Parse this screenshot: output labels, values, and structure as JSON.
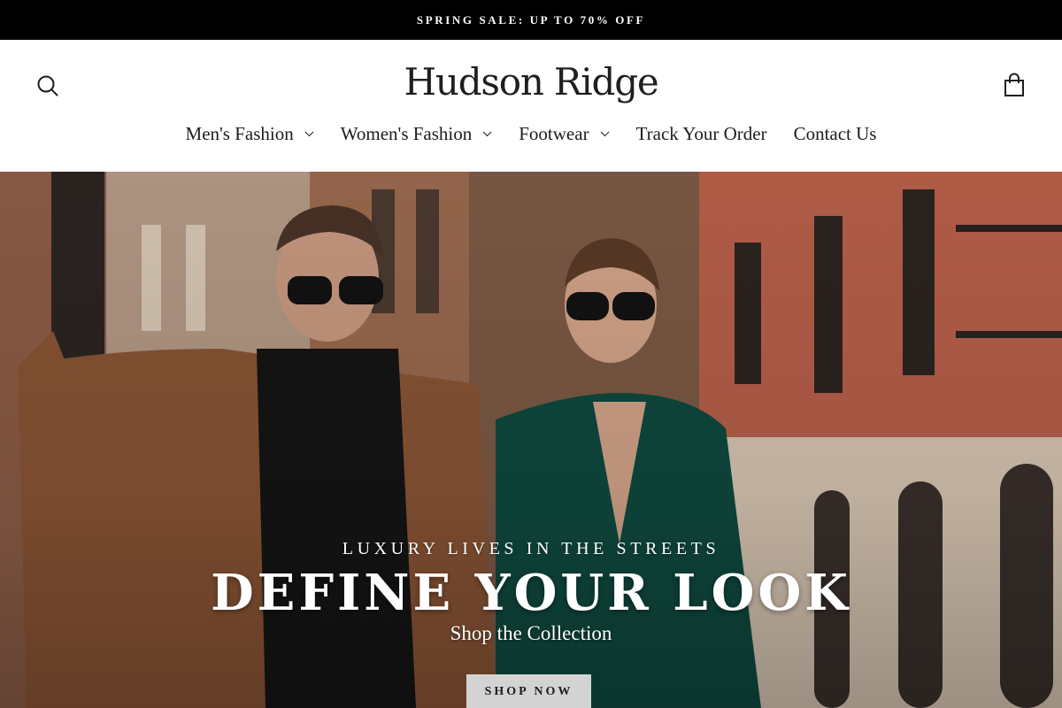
{
  "announcement": {
    "text": "SPRING SALE: UP TO 70% OFF"
  },
  "header": {
    "logo": "Hudson Ridge",
    "search_icon": "search-icon",
    "cart_icon": "shopping-bag-icon"
  },
  "nav": {
    "items": [
      {
        "label": "Men's Fashion",
        "has_dropdown": true
      },
      {
        "label": "Women's Fashion",
        "has_dropdown": true
      },
      {
        "label": "Footwear",
        "has_dropdown": true
      },
      {
        "label": "Track Your Order",
        "has_dropdown": false
      },
      {
        "label": "Contact Us",
        "has_dropdown": false
      }
    ]
  },
  "hero": {
    "eyebrow": "LUXURY LIVES IN THE STREETS",
    "title": "DEFINE YOUR LOOK",
    "subtitle": "Shop the Collection",
    "cta_label": "SHOP NOW"
  },
  "colors": {
    "announcement_bg": "#000000",
    "text": "#1c1d1d",
    "cta_bg": "#d3d3d3"
  }
}
